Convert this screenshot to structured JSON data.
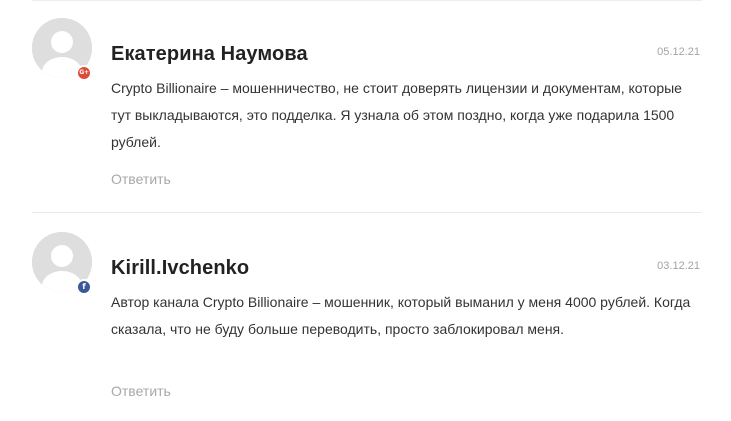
{
  "comments": [
    {
      "author": "Екатерина Наумова",
      "date": "05.12.21",
      "social": "google-plus-icon",
      "social_badge_text": "G+",
      "social_color": "#dd4b39",
      "text": "Crypto Billionaire – мошенничество, не стоит доверять лицензии и документам, которые тут выкладываются, это подделка. Я узнала об этом поздно, когда уже подарила 1500 рублей.",
      "reply_label": "Ответить"
    },
    {
      "author": "Kirill.Ivchenko",
      "date": "03.12.21",
      "social": "facebook-icon",
      "social_badge_text": "f",
      "social_color": "#3b5998",
      "text": "Автор канала Crypto Billionaire – мошенник, который выманил у меня 4000 рублей. Когда сказала, что не буду больше переводить, просто заблокировал меня.",
      "reply_label": "Ответить"
    }
  ]
}
